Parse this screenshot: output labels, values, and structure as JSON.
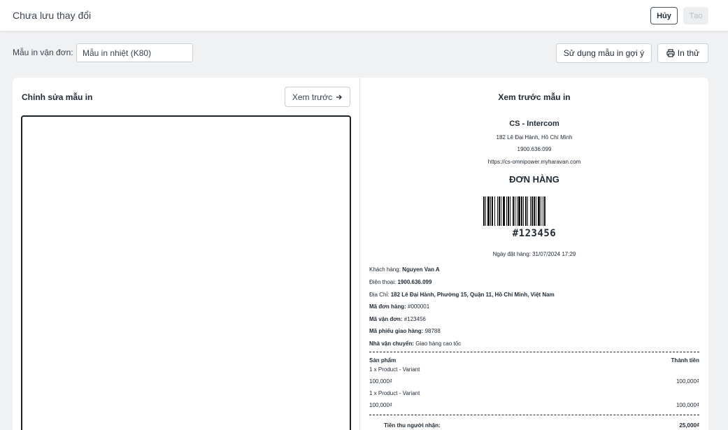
{
  "header": {
    "title": "Chưa lưu thay đổi",
    "cancel_label": "Hủy",
    "create_label": "Tạo"
  },
  "toolbar": {
    "template_label": "Mẫu in vận đơn:",
    "template_value": "Mẫu in nhiệt (K80)",
    "suggest_label": "Sử dụng mẫu in gợi ý",
    "print_label": "In thử",
    "print_icon": "printer-icon"
  },
  "editor": {
    "title": "Chỉnh sửa mẫu in",
    "preview_button": "Xem trước",
    "preview_icon": "arrow-right-icon"
  },
  "preview": {
    "title": "Xem trước mẫu in",
    "store_name": "CS - Intercom",
    "store_address": "182 Lê Đại Hành, Hồ Chí Minh",
    "store_phone": "1900.636.099",
    "store_url": "https://cs-omnipower.myharavan.com",
    "doc_title": "ĐƠN HÀNG",
    "order_code": "#123456",
    "order_date": "Ngày đặt hàng: 31/07/2024 17:29",
    "customer_label": "Khách hàng:",
    "customer_value": "Nguyen Van A",
    "phone_label": "Điện thoại:",
    "phone_value": "1900.636.099",
    "address_label": "Địa Chỉ:",
    "address_value": "182 Lê Đại Hành, Phường 15, Quận 11, Hồ Chí Minh, Việt Nam",
    "order_no_label": "Mã đơn hàng:",
    "order_no_value": "#000001",
    "shipping_no_label": "Mã vận đơn:",
    "shipping_no_value": "#123456",
    "delivery_slip_label": "Mã phiếu giao hàng:",
    "delivery_slip_value": "98788",
    "carrier_label": "Nhà vận chuyển:",
    "carrier_value": "Giao hàng cao tốc",
    "col_product": "Sản phẩm",
    "col_amount": "Thành tiền",
    "items": [
      {
        "name": "1 x Product - Variant",
        "price": "100,000₫",
        "amount": "100,000₫"
      },
      {
        "name": "1 x Product - Variant",
        "price": "100,000₫",
        "amount": "100,000₫"
      }
    ],
    "collect_label": "Tiền thu người nhận:",
    "collect_value": "25,000₫"
  }
}
